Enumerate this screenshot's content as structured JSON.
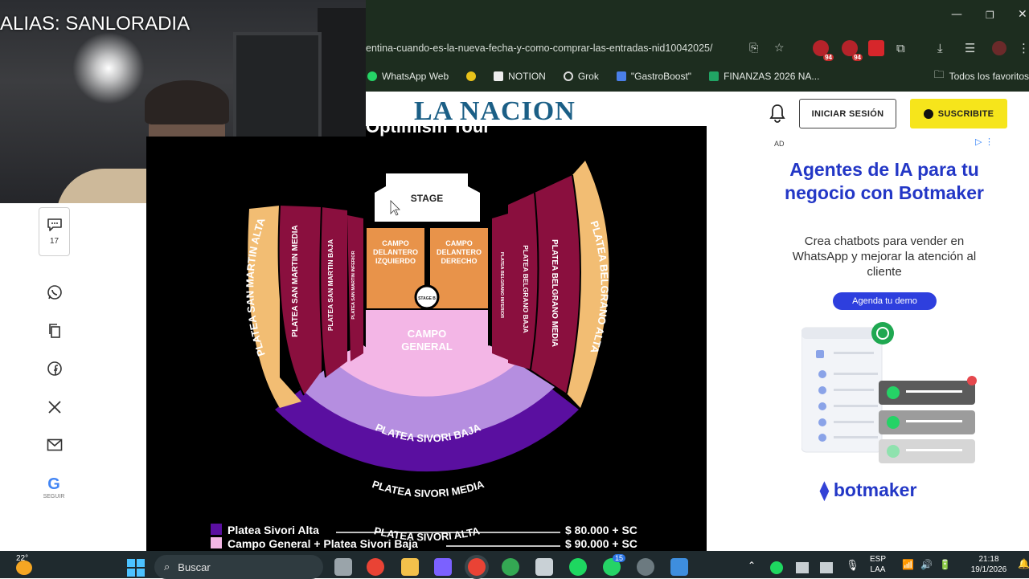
{
  "webcam": {
    "caption": "ALIAS: SANLORADIA"
  },
  "browser": {
    "url": "entina-cuando-es-la-nueva-fecha-y-como-comprar-las-entradas-nid10042025/",
    "extension_badges": [
      "94",
      "94"
    ],
    "bookmarks": [
      "WhatsApp Web",
      "NOTION",
      "Grok",
      "\"GastroBoost\"",
      "FINANZAS 2026 NA..."
    ],
    "bookmarks_folder": "Todos los favoritos"
  },
  "header": {
    "logo": "LA NACION",
    "login_label": "INICIAR SESIÓN",
    "subscribe_label": "SUSCRIBITE"
  },
  "share": {
    "comment_count": "17",
    "google_follow": "SEGUIR"
  },
  "map": {
    "cropped_title": "Optimism Tour",
    "stage": "STAGE",
    "stage_b": "STAGE B",
    "campo_izq": [
      "CAMPO",
      "DELANTERO",
      "IZQUIERDO"
    ],
    "campo_der": [
      "CAMPO",
      "DELANTERO",
      "DERECHO"
    ],
    "campo_general": [
      "CAMPO",
      "GENERAL"
    ],
    "sivori_baja": "PLATEA SIVORI BAJA",
    "sivori_media": "PLATEA SIVORI MEDIA",
    "sivori_alta": "PLATEA SIVORI ALTA",
    "sm_alta": "PLATEA SAN MARTIN ALTA",
    "sm_media": "PLATEA SAN MARTIN MEDIA",
    "sm_baja": "PLATEA SAN MARTIN BAJA",
    "sm_inferior": "PLATEA SAN MARTIN INFERIOR",
    "bel_inferior": "PLATEA BELGRANO INFERIOR",
    "bel_baja": "PLATEA BELGRANO BAJA",
    "bel_media": "PLATEA BELGRANO MEDIA",
    "bel_alta": "PLATEA BELGRANO ALTA",
    "prices": [
      {
        "label": "Platea Sivori Alta",
        "price": "$ 80.000 + SC",
        "color": "#5a0fa0"
      },
      {
        "label": "Campo General + Platea Sivori Baja",
        "price": "$ 90.000 + SC",
        "color": "#f3b6e6"
      }
    ]
  },
  "ad": {
    "tag": "AD",
    "title": "Agentes de IA para tu negocio con Botmaker",
    "text": "Crea chatbots para vender en WhatsApp y mejorar la atención al cliente",
    "button": "Agenda tu demo",
    "brand": "botmaker"
  },
  "taskbar": {
    "temperature": "22°",
    "search_placeholder": "Buscar",
    "whatsapp_badge": "15",
    "lang": "ESP",
    "lang_sub": "LAA",
    "time": "21:18",
    "date": "19/1/2026"
  },
  "colors": {
    "logo": "#1b5f86",
    "subscribe": "#f6e51b",
    "ad_blue": "#2337c6",
    "maroon": "#8a0f3e",
    "orange": "#e8934a",
    "sand": "#f2bd73"
  }
}
